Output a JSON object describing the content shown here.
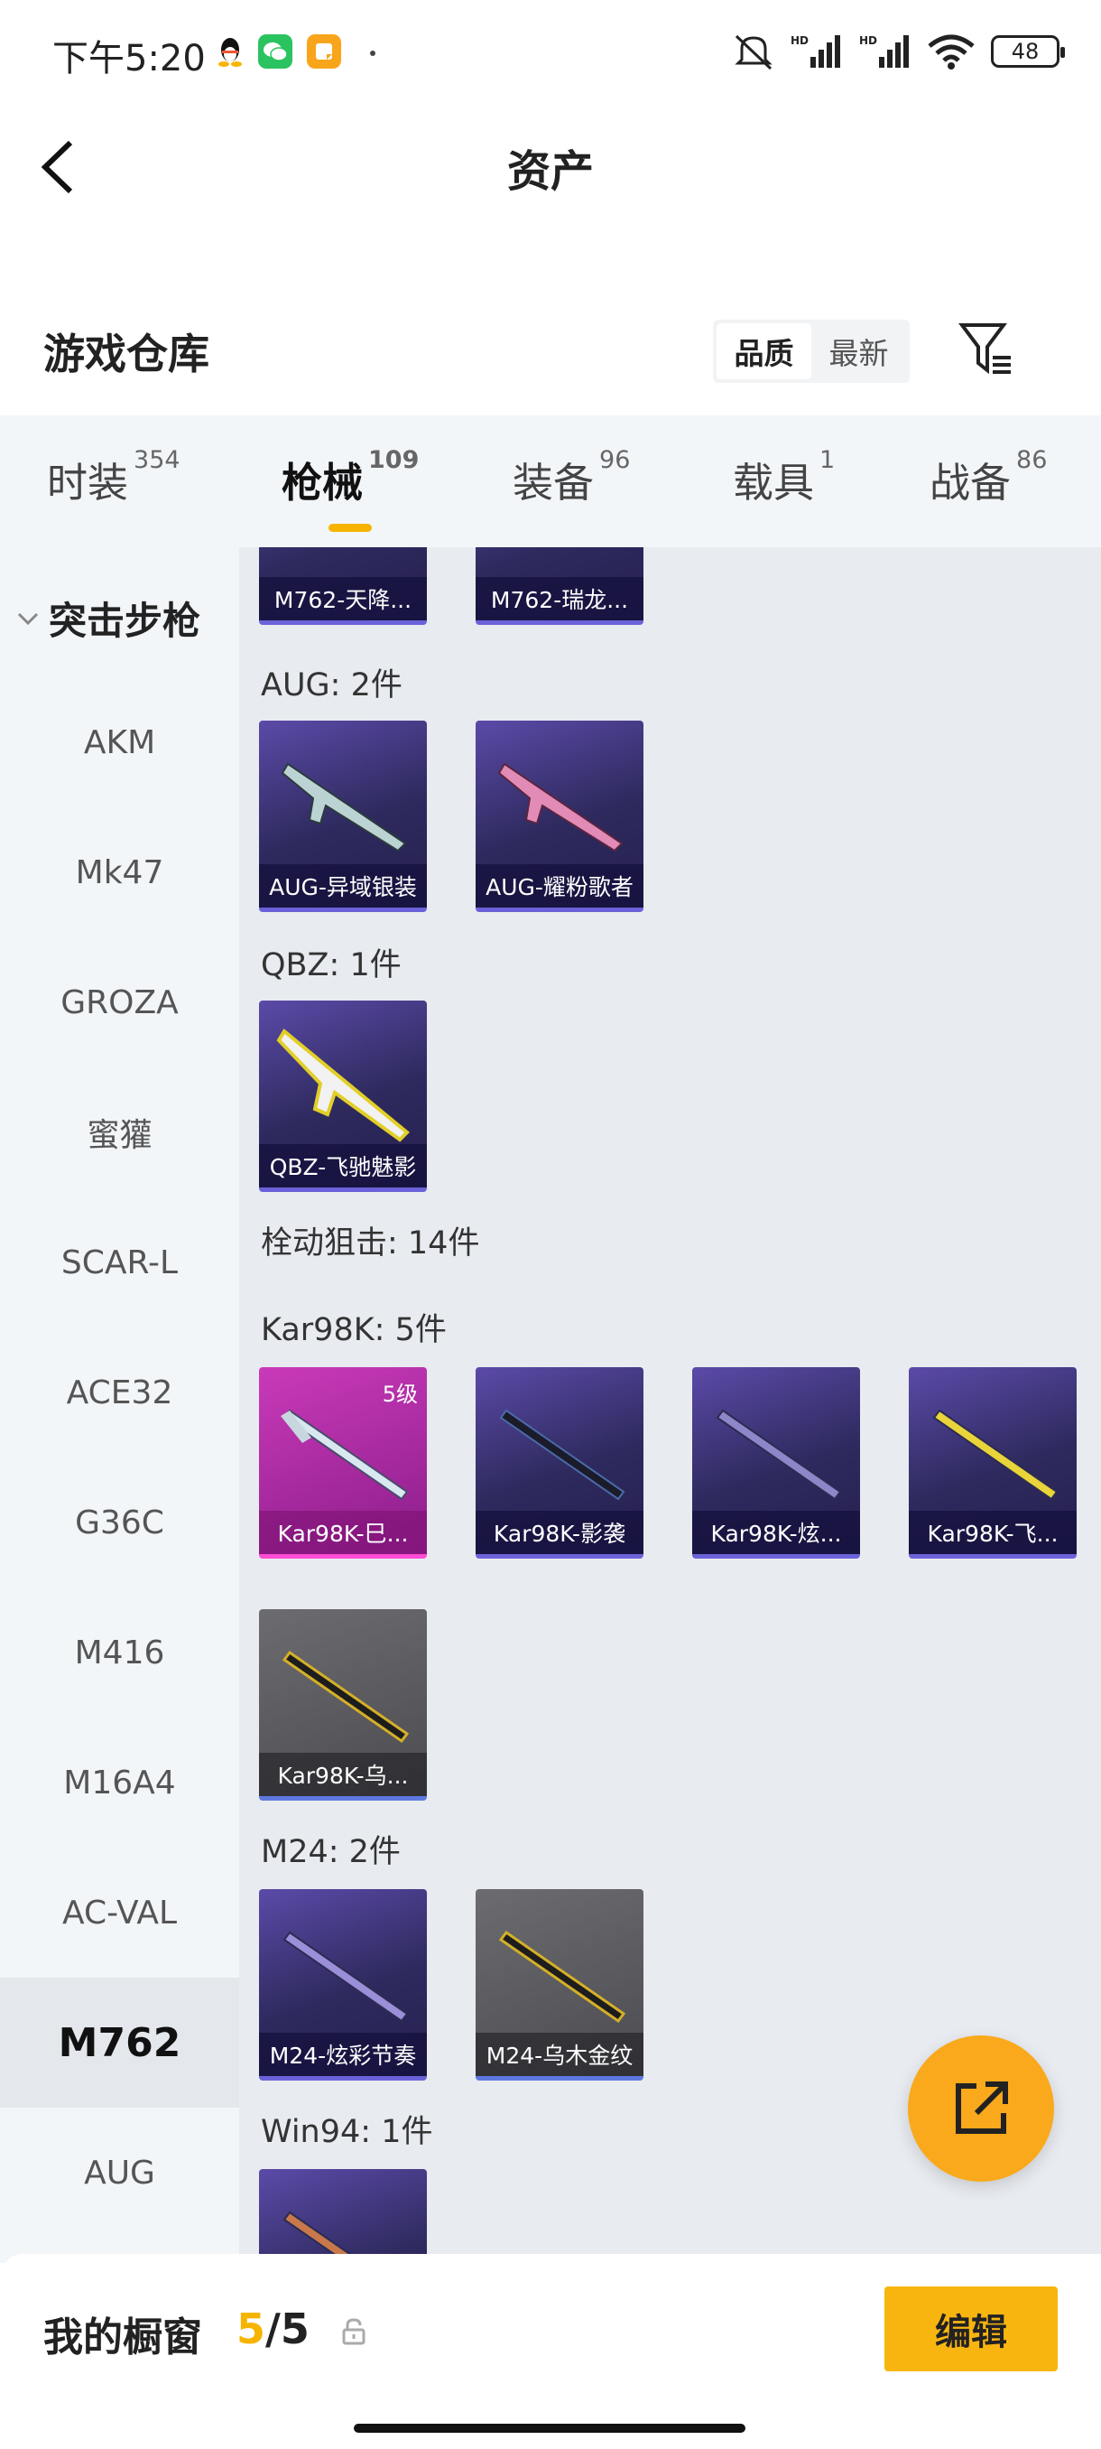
{
  "status_bar": {
    "time": "下午5:20",
    "battery": "48",
    "apps": [
      {
        "icon": "qq-icon",
        "color": "#111111"
      },
      {
        "icon": "wechat-icon",
        "color": "#2bc35f"
      },
      {
        "icon": "notes-icon",
        "color": "#f8a51c"
      }
    ]
  },
  "header": {
    "title": "资产"
  },
  "warehouse": {
    "title": "游戏仓库",
    "sort": [
      "品质",
      "最新"
    ],
    "sort_active": "品质"
  },
  "tabs": [
    {
      "label": "时装",
      "count": "354"
    },
    {
      "label": "枪械",
      "count": "109",
      "active": true
    },
    {
      "label": "装备",
      "count": "96"
    },
    {
      "label": "载具",
      "count": "1"
    },
    {
      "label": "战备",
      "count": "86"
    }
  ],
  "sidebar": {
    "category": "突击步枪",
    "items": [
      "AKM",
      "Mk47",
      "GROZA",
      "蜜獾",
      "SCAR-L",
      "ACE32",
      "G36C",
      "M416",
      "M16A4",
      "AC-VAL",
      "M762",
      "AUG"
    ],
    "active": "M762"
  },
  "content": {
    "top_cards": [
      "M762-天降...",
      "M762-瑞龙..."
    ],
    "aug": {
      "title": "AUG: 2件",
      "cards": [
        "AUG-异域银装",
        "AUG-耀粉歌者"
      ]
    },
    "qbz": {
      "title": "QBZ: 1件",
      "cards": [
        "QBZ-飞驰魅影"
      ]
    },
    "sniper": {
      "title": "栓动狙击: 14件"
    },
    "kar": {
      "title": "Kar98K: 5件",
      "cards": [
        "Kar98K-巳...",
        "Kar98K-影袭",
        "Kar98K-炫...",
        "Kar98K-飞...",
        "Kar98K-乌..."
      ],
      "level_badge": "5级"
    },
    "m24": {
      "title": "M24: 2件",
      "cards": [
        "M24-炫彩节奏",
        "M24-乌木金纹"
      ]
    },
    "win94": {
      "title": "Win94: 1件"
    }
  },
  "showcase": {
    "title": "我的橱窗",
    "current": "5",
    "total": "/5",
    "edit_label": "编辑"
  }
}
